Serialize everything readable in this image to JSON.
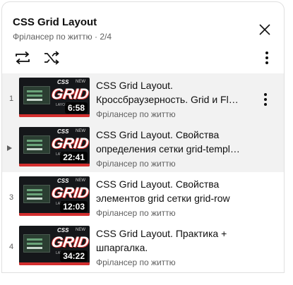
{
  "header": {
    "title": "CSS Grid Layout",
    "channel": "Фрілансер по життю",
    "separator": "·",
    "position": "2/4",
    "icons": {
      "close": "close-icon",
      "loop": "loop-icon",
      "shuffle": "shuffle-icon",
      "menu": "more-vert-icon"
    }
  },
  "items": [
    {
      "index": "1",
      "duration": "6:58",
      "title_line1": "CSS Grid Layout.",
      "title_line2": "Кроссбраузерность. Grid и Flexbox",
      "channel": "Фрілансер по життю",
      "playing": false
    },
    {
      "index": "",
      "duration": "22:41",
      "title_line1": "CSS Grid Layout. Свойства",
      "title_line2": "определения сетки grid-template",
      "channel": "Фрілансер по життю",
      "playing": true
    },
    {
      "index": "3",
      "duration": "12:03",
      "title_line1": "CSS Grid Layout. Свойства",
      "title_line2": "элементов grid сетки grid-row",
      "channel": "Фрілансер по життю",
      "playing": false
    },
    {
      "index": "4",
      "duration": "34:22",
      "title_line1": "CSS Grid Layout. Практика +",
      "title_line2": "шпаргалка.",
      "channel": "Фрілансер по життю",
      "playing": false
    }
  ],
  "thumbnail": {
    "css_tag": "CSS",
    "grid_word": "GRID",
    "new_tag": "NEW",
    "sub_word": "LAYOUT"
  },
  "colors": {
    "accent_red": "#d32f2f",
    "row_highlight": "#f2f2f2",
    "secondary_text": "#606060"
  }
}
